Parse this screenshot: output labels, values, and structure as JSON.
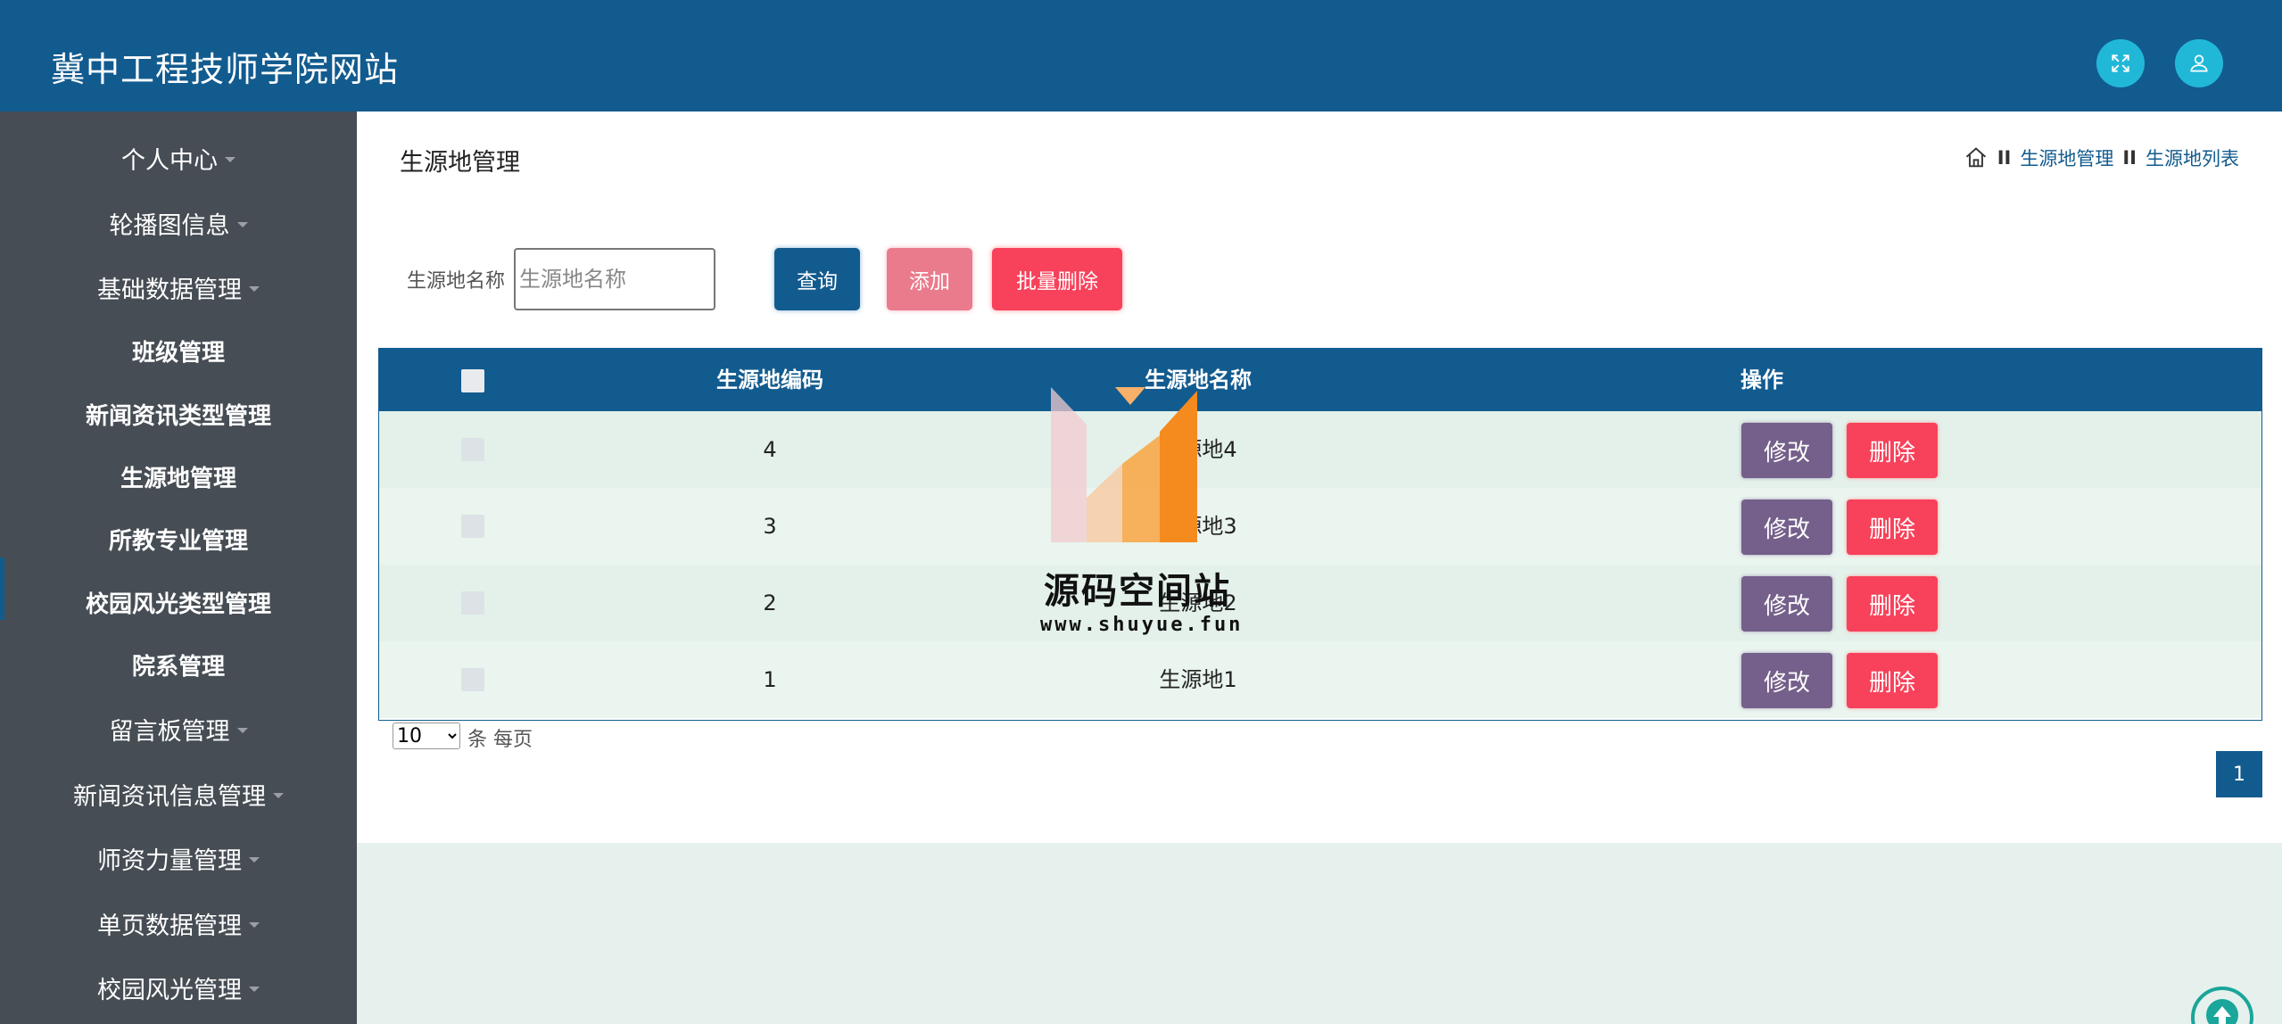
{
  "header": {
    "site_title": "冀中工程技师学院网站",
    "icons": [
      "fullscreen-icon",
      "user-icon"
    ],
    "bg_color": "#125b8f",
    "icon_bg": "#21b8d8"
  },
  "sidebar": {
    "bg_color": "#464d54",
    "items": [
      {
        "label": "个人中心",
        "dropdown": true
      },
      {
        "label": "轮播图信息",
        "dropdown": true
      },
      {
        "label": "基础数据管理",
        "dropdown": true
      },
      {
        "label": "班级管理",
        "dropdown": false
      },
      {
        "label": "新闻资讯类型管理",
        "dropdown": false
      },
      {
        "label": "生源地管理",
        "dropdown": false,
        "active": true
      },
      {
        "label": "所教专业管理",
        "dropdown": false
      },
      {
        "label": "校园风光类型管理",
        "dropdown": false
      },
      {
        "label": "院系管理",
        "dropdown": false
      },
      {
        "label": "留言板管理",
        "dropdown": true
      },
      {
        "label": "新闻资讯信息管理",
        "dropdown": true
      },
      {
        "label": "师资力量管理",
        "dropdown": true
      },
      {
        "label": "单页数据管理",
        "dropdown": true
      },
      {
        "label": "校园风光管理",
        "dropdown": true
      }
    ]
  },
  "page": {
    "title": "生源地管理",
    "breadcrumb": {
      "home_icon": "home-icon",
      "sep": "II",
      "level1": "生源地管理",
      "level2": "生源地列表"
    }
  },
  "search": {
    "label": "生源地名称",
    "placeholder": "生源地名称",
    "query_label": "查询",
    "add_label": "添加",
    "batch_delete_label": "批量删除"
  },
  "table": {
    "headers": {
      "code": "生源地编码",
      "name": "生源地名称",
      "action": "操作"
    },
    "rows": [
      {
        "code": "4",
        "name": "生源地4"
      },
      {
        "code": "3",
        "name": "生源地3"
      },
      {
        "code": "2",
        "name": "生源地2"
      },
      {
        "code": "1",
        "name": "生源地1"
      }
    ],
    "edit_label": "修改",
    "delete_label": "删除"
  },
  "pagination": {
    "page_size": "10",
    "page_size_suffix": "条 每页",
    "current_page": "1"
  },
  "watermark": {
    "title": "源码空间站",
    "url": "www.shuyue.fun"
  },
  "scroll_top_icon": "arrow-up-icon"
}
